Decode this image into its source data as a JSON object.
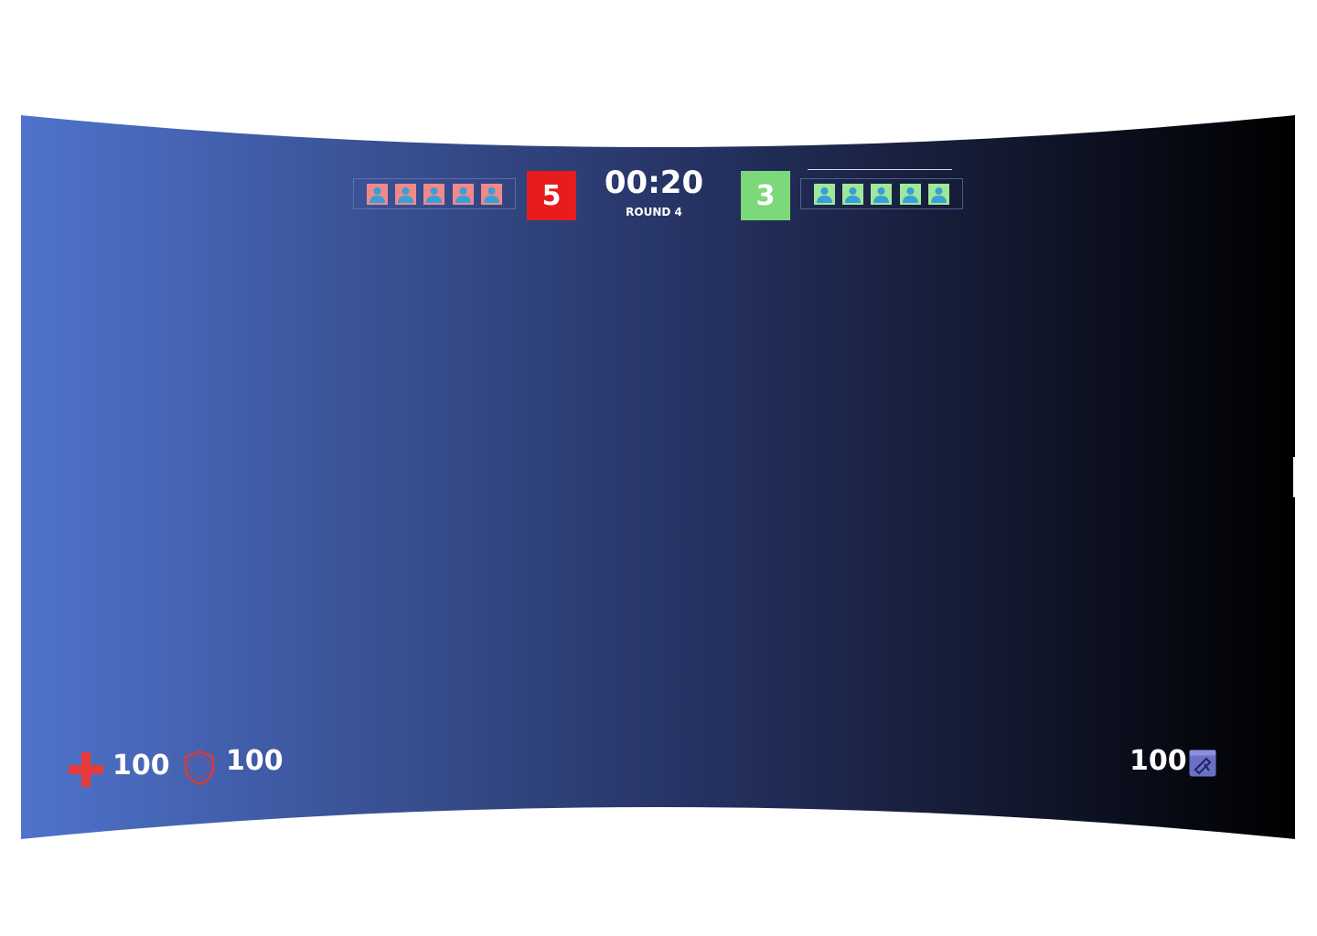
{
  "scoreboard": {
    "timer": "00:20",
    "round_label": "ROUND 4",
    "team_left": {
      "score": "5",
      "color": "#e81c1c",
      "slot_color": "#f08a8a",
      "players": 5
    },
    "team_right": {
      "score": "3",
      "color": "#7dd87a",
      "slot_color": "#9fe79a",
      "players": 5
    },
    "avatar_color": "#3a9fd6"
  },
  "hud": {
    "health": {
      "icon": "health-cross-icon",
      "value": "100",
      "color": "#e53b3b"
    },
    "armor": {
      "icon": "shield-icon",
      "value": "100",
      "color": "#e03a3a"
    },
    "ammo": {
      "icon": "ammo-icon",
      "value": "100",
      "color": "#6a70c8"
    }
  },
  "background": {
    "gradient_start": "#4f73cc",
    "gradient_end": "#000000"
  }
}
